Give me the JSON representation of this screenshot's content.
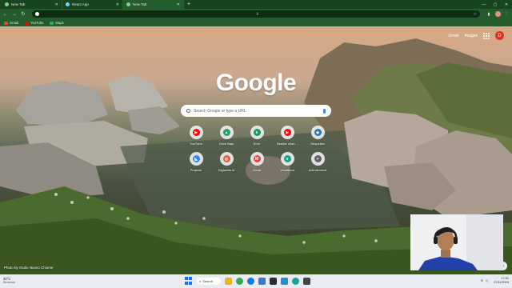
{
  "tabs": [
    {
      "title": "New Tab",
      "icon": "chrome-icon"
    },
    {
      "title": "React App",
      "icon": "react-icon"
    },
    {
      "title": "New Tab",
      "icon": "chrome-icon"
    }
  ],
  "new_tab_symbol": "+",
  "omnibox": {
    "value": ""
  },
  "bookmarks": [
    {
      "label": "Gmail",
      "color": "#ea4335"
    },
    {
      "label": "YouTube",
      "color": "#ff0000"
    },
    {
      "label": "Maps",
      "color": "#34a853"
    }
  ],
  "page": {
    "top_links": {
      "gmail": "Gmail",
      "images": "Images",
      "profile_initial": "D"
    },
    "logo": "Google",
    "search_placeholder": "Search Google or type a URL",
    "shortcuts": [
      {
        "label": "YouTube",
        "glyph": "▶",
        "color": "#ff0000"
      },
      {
        "label": "Drive Bajo",
        "glyph": "▲",
        "color": "#1fa463"
      },
      {
        "label": "Emir",
        "glyph": "e",
        "color": "#0f9d58"
      },
      {
        "label": "Bsedar chan...",
        "glyph": "▶",
        "color": "#ff0000"
      },
      {
        "label": "Sequelize",
        "glyph": "◆",
        "color": "#2379bd"
      },
      {
        "label": "Projects",
        "glyph": "◣",
        "color": "#3b82f6"
      },
      {
        "label": "Digiwebs.id",
        "glyph": "◎",
        "color": "#e05d44"
      },
      {
        "label": "Gmail",
        "glyph": "M",
        "color": "#ea4335"
      },
      {
        "label": "Vocalbout",
        "glyph": "v",
        "color": "#16a085"
      },
      {
        "label": "Add shortcut",
        "glyph": "+",
        "color": "#5f6368"
      }
    ],
    "photo_credit": "Photo by Giulio Nuovo Chiome"
  },
  "taskbar": {
    "weather_temp": "30°C",
    "weather_desc": "Berawan",
    "search_label": "Search",
    "time": "17:51",
    "date": "27/11/2023",
    "apps": [
      {
        "name": "file-explorer",
        "color": "#f4b400"
      },
      {
        "name": "chrome",
        "color": "#34a853"
      },
      {
        "name": "edge",
        "color": "#0f7bd8"
      },
      {
        "name": "store",
        "color": "#3a78d6"
      },
      {
        "name": "terminal",
        "color": "#2b2b2b"
      },
      {
        "name": "vscode",
        "color": "#2a89d8"
      },
      {
        "name": "app-teal",
        "color": "#1aa39b"
      },
      {
        "name": "app-dark",
        "color": "#444444"
      }
    ]
  },
  "colors": {
    "frame": "#245c2e",
    "tabstrip": "#16451f"
  }
}
